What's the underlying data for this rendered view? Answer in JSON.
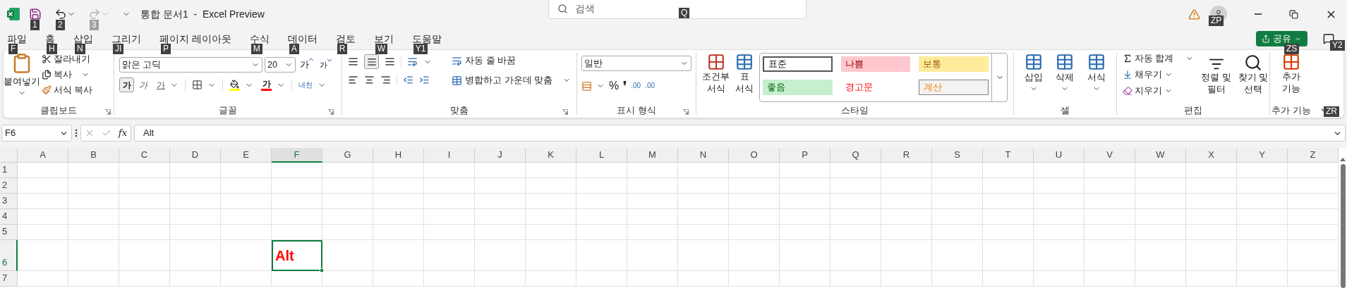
{
  "title_bar": {
    "quick_access": [
      {
        "kind": "save",
        "keytip": "1",
        "disabled": false
      },
      {
        "kind": "undo",
        "keytip": "2",
        "disabled": false
      },
      {
        "kind": "redo",
        "keytip": "3",
        "disabled": true
      }
    ],
    "title": "통합 문서1  -  Excel Preview",
    "search": {
      "placeholder": "검색",
      "keytip": "Q"
    },
    "account_keytip": "ZP"
  },
  "tabs": [
    {
      "label": "파일",
      "keytip": "F"
    },
    {
      "label": "홈",
      "keytip": "H"
    },
    {
      "label": "삽입",
      "keytip": "N"
    },
    {
      "label": "그리기",
      "keytip": "JI"
    },
    {
      "label": "페이지 레이아웃",
      "keytip": "P"
    },
    {
      "label": "수식",
      "keytip": "M"
    },
    {
      "label": "데이터",
      "keytip": "A"
    },
    {
      "label": "검토",
      "keytip": "R"
    },
    {
      "label": "보기",
      "keytip": "W"
    },
    {
      "label": "도움말",
      "keytip": "Y1"
    }
  ],
  "share": {
    "label": "공유",
    "keytip": "ZS"
  },
  "comments_keytip": "Y2",
  "ribbon": {
    "clipboard": {
      "label": "클립보드",
      "paste": "붙여넣기",
      "cut": "잘라내기",
      "copy": "복사",
      "format_painter": "서식 복사"
    },
    "font": {
      "label": "글꼴",
      "font_name": "맑은 고딕",
      "font_size": "20",
      "grow": "가",
      "shrink": "가",
      "bold": "가",
      "italic": "가",
      "underline": "가",
      "font_color": "가",
      "phonetic": "내천"
    },
    "alignment": {
      "label": "맞춤",
      "wrap": "자동 줄 바꿈",
      "merge": "병합하고 가운데 맞춤"
    },
    "number": {
      "label": "표시 형식",
      "format": "일반",
      "percent": "%",
      "comma": "❜",
      "increase_decimal": ".00",
      "decrease_decimal": ".00"
    },
    "styles": {
      "label": "스타일",
      "conditional": "조건부\n서식",
      "table": "표\n서식",
      "cell_styles": [
        {
          "label": "표준",
          "kind": "normal"
        },
        {
          "label": "나쁨",
          "kind": "bad"
        },
        {
          "label": "보통",
          "kind": "neutral"
        },
        {
          "label": "좋음",
          "kind": "good"
        },
        {
          "label": "경고문",
          "kind": "warning"
        },
        {
          "label": "계산",
          "kind": "calculation"
        }
      ]
    },
    "cells": {
      "label": "셀",
      "insert": "삽입",
      "delete": "삭제",
      "format": "서식"
    },
    "editing": {
      "label": "편집",
      "autosum": "자동 합계",
      "fill": "채우기",
      "clear": "지우기",
      "sort": "정렬 및\n필터",
      "find": "찾기 및\n선택"
    },
    "addins": {
      "label": "추가 기능",
      "button": "추가\n기능",
      "keytip": "ZR"
    }
  },
  "formula_bar": {
    "name_box": "F6",
    "fx": "fx",
    "formula": "Alt"
  },
  "sheet": {
    "columns": [
      {
        "label": "A",
        "selected": false
      },
      {
        "label": "B",
        "selected": false
      },
      {
        "label": "C",
        "selected": false
      },
      {
        "label": "D",
        "selected": false
      },
      {
        "label": "E",
        "selected": false
      },
      {
        "label": "F",
        "selected": true
      },
      {
        "label": "G",
        "selected": false
      },
      {
        "label": "H",
        "selected": false
      },
      {
        "label": "I",
        "selected": false
      },
      {
        "label": "J",
        "selected": false
      },
      {
        "label": "K",
        "selected": false
      },
      {
        "label": "L",
        "selected": false
      },
      {
        "label": "M",
        "selected": false
      },
      {
        "label": "N",
        "selected": false
      },
      {
        "label": "O",
        "selected": false
      },
      {
        "label": "P",
        "selected": false
      },
      {
        "label": "Q",
        "selected": false
      },
      {
        "label": "R",
        "selected": false
      },
      {
        "label": "S",
        "selected": false
      },
      {
        "label": "T",
        "selected": false
      },
      {
        "label": "U",
        "selected": false
      },
      {
        "label": "V",
        "selected": false
      },
      {
        "label": "W",
        "selected": false
      },
      {
        "label": "X",
        "selected": false
      },
      {
        "label": "Y",
        "selected": false
      },
      {
        "label": "Z",
        "selected": false
      }
    ],
    "rows": [
      {
        "label": "1",
        "selected": false
      },
      {
        "label": "2",
        "selected": false
      },
      {
        "label": "3",
        "selected": false
      },
      {
        "label": "4",
        "selected": false
      },
      {
        "label": "5",
        "selected": false
      },
      {
        "label": "6",
        "selected": true,
        "value": "Alt"
      },
      {
        "label": "7",
        "selected": false
      }
    ]
  }
}
